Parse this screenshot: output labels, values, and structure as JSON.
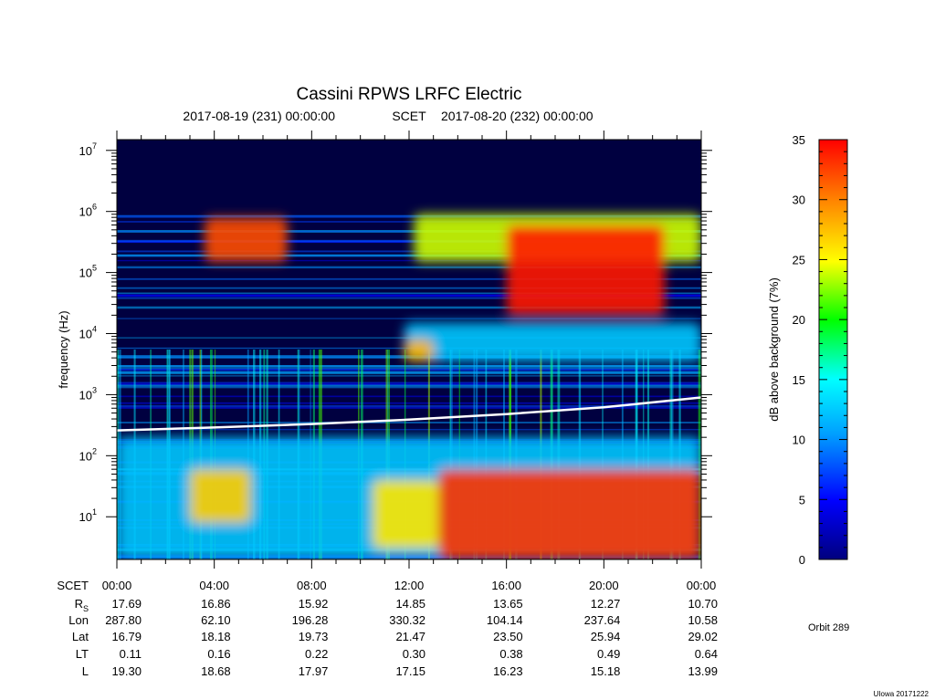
{
  "chart_data": [
    {
      "type": "heatmap",
      "title": "Cassini RPWS LRFC Electric",
      "subtitle": {
        "start": "2017-08-19 (231) 00:00:00",
        "label": "SCET",
        "end": "2017-08-20 (232) 00:00:00"
      },
      "ylabel": "frequency (Hz)",
      "yscale": "log",
      "ylim": [
        2,
        15000000
      ],
      "y_ticks": [
        {
          "base": "10",
          "exp": "1",
          "value": 10
        },
        {
          "base": "10",
          "exp": "2",
          "value": 100
        },
        {
          "base": "10",
          "exp": "3",
          "value": 1000
        },
        {
          "base": "10",
          "exp": "4",
          "value": 10000
        },
        {
          "base": "10",
          "exp": "5",
          "value": 100000
        },
        {
          "base": "10",
          "exp": "6",
          "value": 1000000
        },
        {
          "base": "10",
          "exp": "7",
          "value": 10000000
        }
      ],
      "xlim": [
        0,
        24
      ],
      "x_unit": "hours SCET",
      "white_line": {
        "x": [
          0,
          4,
          8,
          12,
          16,
          20,
          24
        ],
        "y": [
          260,
          290,
          330,
          390,
          480,
          620,
          900
        ]
      },
      "regions": [
        {
          "x": [
            3.6,
            7.0
          ],
          "y": [
            150000,
            800000
          ],
          "level": 32
        },
        {
          "x": [
            12.2,
            24.0
          ],
          "y": [
            150000,
            900000
          ],
          "level": 24
        },
        {
          "x": [
            16.0,
            22.5
          ],
          "y": [
            20000,
            600000
          ],
          "level": 34
        },
        {
          "x": [
            11.8,
            24.0
          ],
          "y": [
            3500,
            15000
          ],
          "level": 12
        },
        {
          "x": [
            11.8,
            13.0
          ],
          "y": [
            3500,
            8000
          ],
          "level": 28
        },
        {
          "x": [
            13.2,
            24.0
          ],
          "y": [
            2,
            60
          ],
          "level": 33
        },
        {
          "x": [
            10.5,
            13.2
          ],
          "y": [
            3,
            40
          ],
          "level": 26
        },
        {
          "x": [
            3.0,
            5.5
          ],
          "y": [
            8,
            60
          ],
          "level": 27
        },
        {
          "x": [
            0.0,
            24.0
          ],
          "y": [
            2,
            200
          ],
          "level": 12
        }
      ]
    },
    {
      "type": "heatmap",
      "name": "colorbar",
      "ylabel": "dB above background (7%)",
      "ylim": [
        0,
        35
      ],
      "ticks": [
        0,
        5,
        10,
        15,
        20,
        25,
        30,
        35
      ],
      "colors": [
        "#00007e",
        "#0000ff",
        "#00a0ff",
        "#00ffff",
        "#00ff00",
        "#ffff00",
        "#ff8000",
        "#ff0000"
      ]
    }
  ],
  "ephemeris": {
    "row_labels": [
      {
        "main": "SCET",
        "sub": ""
      },
      {
        "main": "R",
        "sub": "S"
      },
      {
        "main": "Lon",
        "sub": ""
      },
      {
        "main": "Lat",
        "sub": ""
      },
      {
        "main": "LT",
        "sub": ""
      },
      {
        "main": "L",
        "sub": ""
      }
    ],
    "scet": [
      "00:00",
      "04:00",
      "08:00",
      "12:00",
      "16:00",
      "20:00",
      "00:00"
    ],
    "rows": [
      [
        "17.69",
        "16.86",
        "15.92",
        "14.85",
        "13.65",
        "12.27",
        "10.70"
      ],
      [
        "287.80",
        "62.10",
        "196.28",
        "330.32",
        "104.14",
        "237.64",
        "10.58"
      ],
      [
        "16.79",
        "18.18",
        "19.73",
        "21.47",
        "23.50",
        "25.94",
        "29.02"
      ],
      [
        "0.11",
        "0.16",
        "0.22",
        "0.30",
        "0.38",
        "0.49",
        "0.64"
      ],
      [
        "19.30",
        "18.68",
        "17.97",
        "17.15",
        "16.23",
        "15.18",
        "13.99"
      ]
    ]
  },
  "orbit": "Orbit  289",
  "credit": "UIowa 20171222"
}
